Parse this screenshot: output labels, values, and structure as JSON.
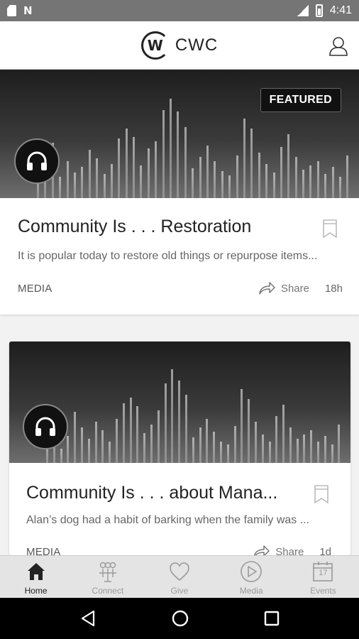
{
  "status_bar": {
    "time": "4:41",
    "left_icons": [
      "sd-card-icon",
      "n-icon"
    ],
    "right_icons": [
      "signal-icon",
      "battery-icon"
    ]
  },
  "header": {
    "logo_mark": "W",
    "logo_text": "CWC",
    "profile_icon": "user-icon"
  },
  "featured_tag": "FEATURED",
  "cards": [
    {
      "title": "Community Is . . . Restoration",
      "excerpt": "It is popular today to restore old things or repurpose items...",
      "category": "MEDIA",
      "share_label": "Share",
      "time": "18h"
    },
    {
      "title": "Community Is . . . about Mana...",
      "excerpt": "Alan’s dog had a habit of barking when the family was ...",
      "category": "MEDIA",
      "share_label": "Share",
      "time": "1d"
    }
  ],
  "bottom_nav": {
    "items": [
      {
        "label": "Home",
        "icon": "home-icon",
        "active": true
      },
      {
        "label": "Connect",
        "icon": "people-icon",
        "active": false
      },
      {
        "label": "Give",
        "icon": "heart-icon",
        "active": false
      },
      {
        "label": "Media",
        "icon": "play-icon",
        "active": false
      },
      {
        "label": "Events",
        "icon": "calendar-icon",
        "active": false
      }
    ],
    "events_day": "17"
  },
  "colors": {
    "status_bar": "#757575",
    "nav_active": "#222222",
    "nav_inactive": "#9a9a9a"
  }
}
